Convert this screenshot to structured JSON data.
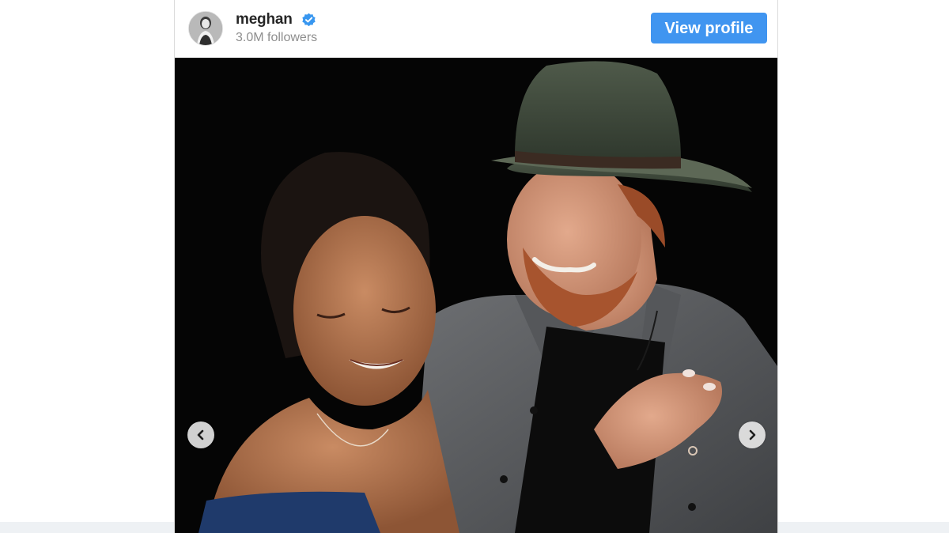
{
  "post_header": {
    "username": "meghan",
    "verified": true,
    "followers": "3.0M followers",
    "view_profile_label": "View profile"
  },
  "icons": {
    "avatar": "profile-photo",
    "verified": "verified-badge-icon",
    "prev": "chevron-left-icon",
    "next": "chevron-right-icon"
  },
  "colors": {
    "button_blue": "#4095f0",
    "verified_blue": "#3897f0",
    "username": "#262626",
    "followers_gray": "#8e8e8e",
    "photo_bg": "#050505"
  }
}
